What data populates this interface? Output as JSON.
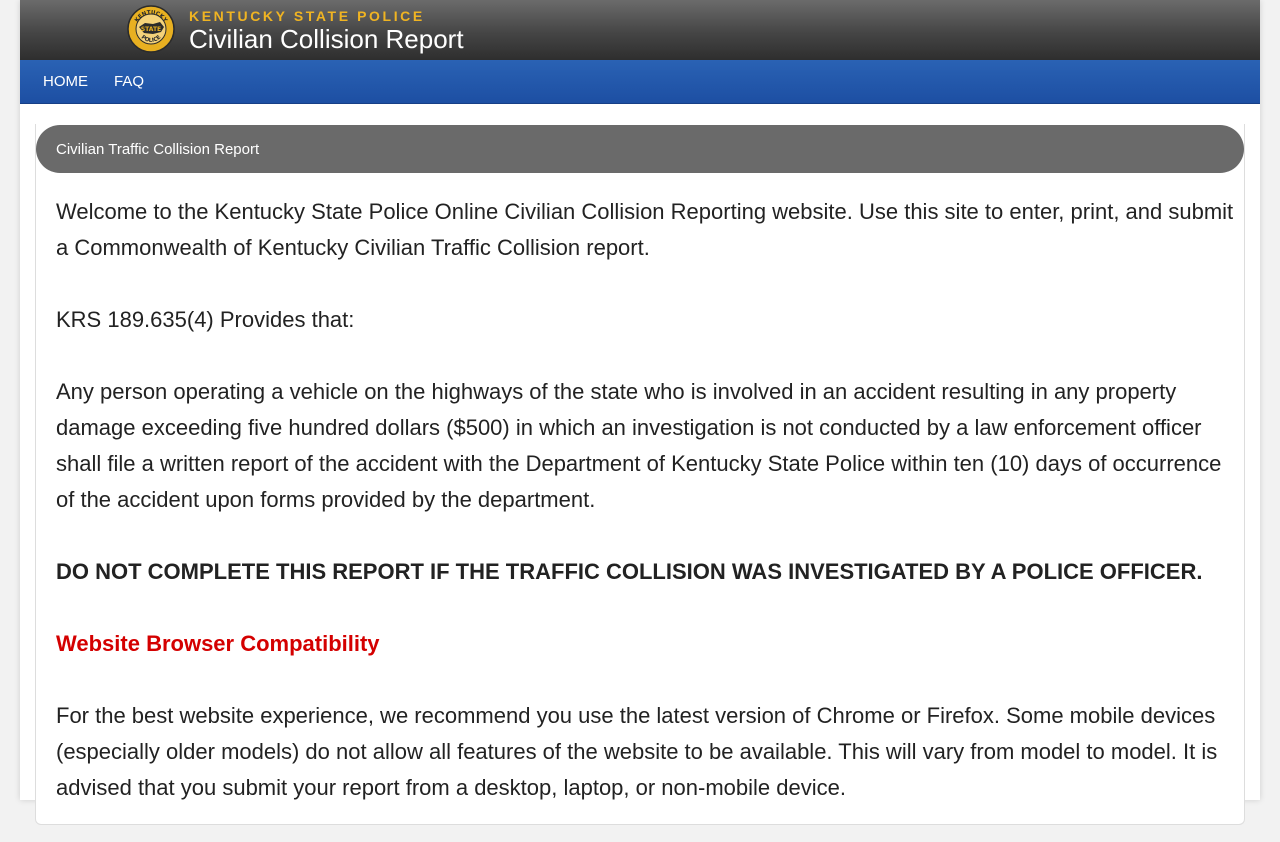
{
  "header": {
    "agency": "KENTUCKY STATE POLICE",
    "title": "Civilian Collision Report",
    "seal": {
      "top_text": "KENTUCKY",
      "center_text": "STATE",
      "bottom_text": "POLICE",
      "color_gold": "#e8b021",
      "color_dark": "#2b2b2b"
    }
  },
  "nav": {
    "items": [
      {
        "label": "HOME"
      },
      {
        "label": "FAQ"
      }
    ]
  },
  "panel": {
    "heading": "Civilian Traffic Collision Report"
  },
  "content": {
    "welcome": "Welcome to the Kentucky State Police Online Civilian Collision Reporting website. Use this site to enter, print, and submit a Commonwealth of Kentucky Civilian Traffic Collision report.",
    "statute_intro": "KRS 189.635(4) Provides that:",
    "statute_text": "Any person operating a vehicle on the highways of the state who is involved in an accident resulting in any property damage exceeding five hundred dollars ($500) in which an investigation is not conducted by a law enforcement officer shall file a written report of the accident with the Department of Kentucky State Police within ten (10) days of occurrence of the accident upon forms provided by the department.",
    "warning": "DO NOT COMPLETE THIS REPORT IF THE TRAFFIC COLLISION WAS INVESTIGATED BY A POLICE OFFICER.",
    "compatibility_title": "Website Browser Compatibility",
    "compatibility_text": "For the best website experience, we recommend you use the latest version of Chrome or Firefox. Some mobile devices (especially older models) do not allow all features of the website to be available. This will vary from model to model. It is advised that you submit your report from a desktop, laptop, or non-mobile device."
  },
  "colors": {
    "accent_gold": "#f0b422",
    "nav_blue": "#1d4fa3",
    "panel_heading": "#6a6a6a",
    "compat_red": "#d40000"
  }
}
